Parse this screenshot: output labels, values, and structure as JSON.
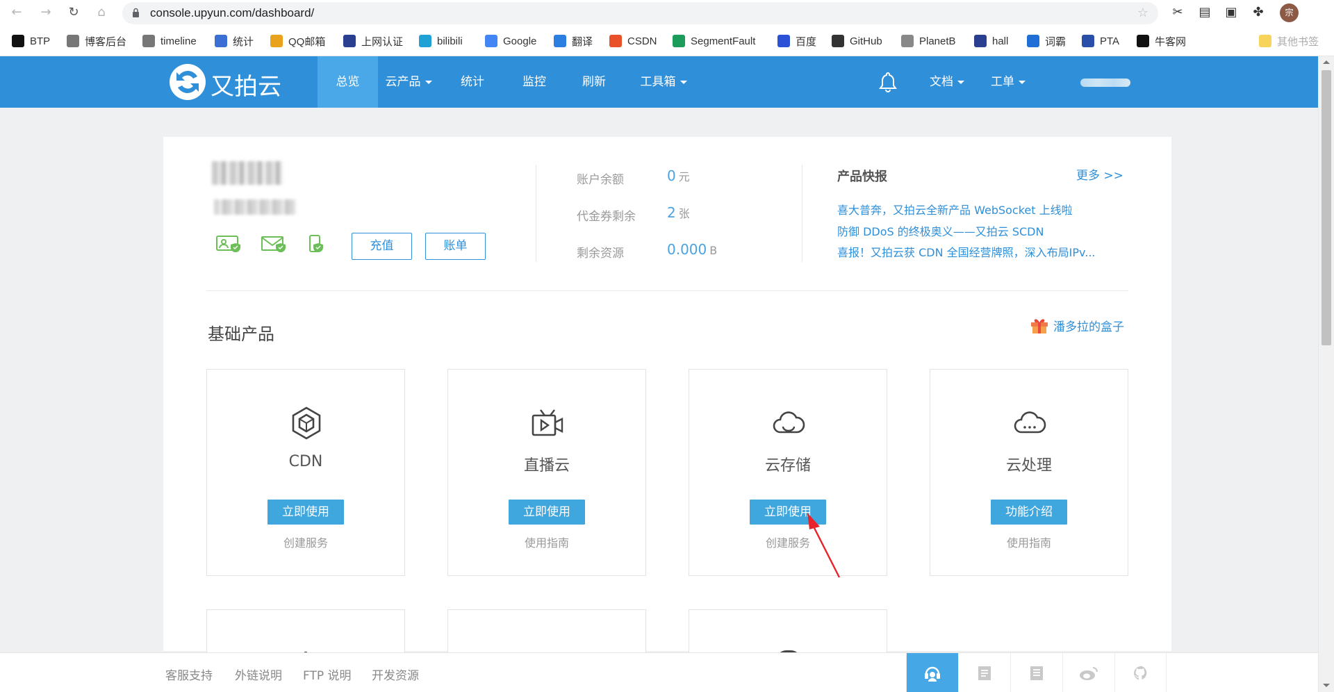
{
  "browser": {
    "url": "console.upyun.com/dashboard/",
    "profile_initial": "宗",
    "bookmarks": [
      {
        "label": "BTP",
        "icon": "btp-icon",
        "color": "#111111"
      },
      {
        "label": "博客后台",
        "icon": "blog-icon",
        "color": "#777777"
      },
      {
        "label": "timeline",
        "icon": "timeline-icon",
        "color": "#777777"
      },
      {
        "label": "统计",
        "icon": "stats-icon",
        "color": "#3b6fd4"
      },
      {
        "label": "QQ邮箱",
        "icon": "qqmail-icon",
        "color": "#e9a21b"
      },
      {
        "label": "上网认证",
        "icon": "auth-icon",
        "color": "#2a3f8f"
      },
      {
        "label": "bilibili",
        "icon": "bilibili-icon",
        "color": "#20a1d6"
      },
      {
        "label": "Google",
        "icon": "google-icon",
        "color": "#4285f4"
      },
      {
        "label": "翻译",
        "icon": "translate-icon",
        "color": "#2a7fe0"
      },
      {
        "label": "CSDN",
        "icon": "csdn-icon",
        "color": "#e8512a"
      },
      {
        "label": "SegmentFault",
        "icon": "segmentfault-icon",
        "color": "#1c9c5a"
      },
      {
        "label": "百度",
        "icon": "baidu-icon",
        "color": "#2b52d6"
      },
      {
        "label": "GitHub",
        "icon": "github-icon",
        "color": "#333333"
      },
      {
        "label": "PlanetB",
        "icon": "planetb-icon",
        "color": "#888888"
      },
      {
        "label": "hall",
        "icon": "hall-icon",
        "color": "#2a3f8f"
      },
      {
        "label": "词霸",
        "icon": "ciba-icon",
        "color": "#1f6fd6"
      },
      {
        "label": "PTA",
        "icon": "pta-icon",
        "color": "#2a4fa8"
      },
      {
        "label": "牛客网",
        "icon": "nowcoder-icon",
        "color": "#111111"
      }
    ],
    "other_bookmarks": "其他书签"
  },
  "app": {
    "brand": "又拍云",
    "nav": [
      {
        "label": "总览",
        "active": true,
        "dropdown": false
      },
      {
        "label": "云产品",
        "active": false,
        "dropdown": true
      },
      {
        "label": "统计",
        "active": false,
        "dropdown": false
      },
      {
        "label": "监控",
        "active": false,
        "dropdown": false
      },
      {
        "label": "刷新",
        "active": false,
        "dropdown": false
      },
      {
        "label": "工具箱",
        "active": false,
        "dropdown": true
      }
    ],
    "right_nav": [
      {
        "label": "文档",
        "dropdown": true
      },
      {
        "label": "工单",
        "dropdown": true
      }
    ]
  },
  "account": {
    "recharge_label": "充值",
    "bill_label": "账单",
    "stats": [
      {
        "label": "账户余额",
        "value": "0",
        "unit": "元"
      },
      {
        "label": "代金券剩余",
        "value": "2",
        "unit": "张"
      },
      {
        "label": "剩余资源",
        "value": "0.000",
        "unit": "B"
      }
    ]
  },
  "news": {
    "title": "产品快报",
    "more": "更多 >>",
    "items": [
      "喜大普奔，又拍云全新产品 WebSocket 上线啦",
      "防御 DDoS 的终极奥义——又拍云 SCDN",
      "喜报！又拍云获 CDN 全国经营牌照，深入布局IPv..."
    ]
  },
  "products": {
    "title": "基础产品",
    "gift_link": "潘多拉的盒子",
    "cards": [
      {
        "name": "CDN",
        "icon": "cdn-cube-icon",
        "button": "立即使用",
        "link": "创建服务"
      },
      {
        "name": "直播云",
        "icon": "live-tv-icon",
        "button": "立即使用",
        "link": "使用指南"
      },
      {
        "name": "云存储",
        "icon": "cloud-storage-icon",
        "button": "立即使用",
        "link": "创建服务"
      },
      {
        "name": "云处理",
        "icon": "cloud-process-icon",
        "button": "功能介绍",
        "link": "使用指南"
      }
    ]
  },
  "footer": {
    "links": [
      "客服支持",
      "外链说明",
      "FTP 说明",
      "开发资源"
    ]
  }
}
